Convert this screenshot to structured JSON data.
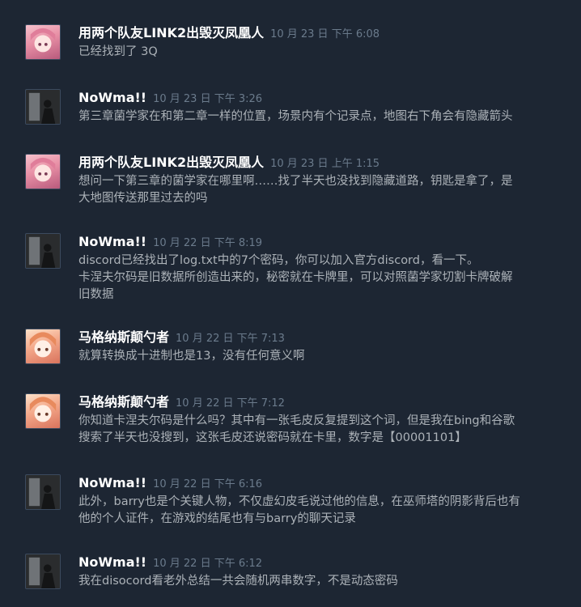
{
  "comments": [
    {
      "author": "用两个队友LINK2出毁灭凤凰人",
      "date": "10 月 23 日 下午 6:08",
      "avatar": "anime-girl-pink",
      "text": "已经找到了 3Q"
    },
    {
      "author": "NoWma!!",
      "date": "10 月 23 日 下午 3:26",
      "avatar": "dark-figure",
      "text": "第三章菌学家在和第二章一样的位置，场景内有个记录点，地图右下角会有隐藏箭头"
    },
    {
      "author": "用两个队友LINK2出毁灭凤凰人",
      "date": "10 月 23 日 上午 1:15",
      "avatar": "anime-girl-pink",
      "text": "想问一下第三章的菌学家在哪里啊……找了半天也没找到隐藏道路，钥匙是拿了，是\n大地图传送那里过去的吗"
    },
    {
      "author": "NoWma!!",
      "date": "10 月 22 日 下午 8:19",
      "avatar": "dark-figure",
      "text": "discord已经找出了log.txt中的7个密码，你可以加入官方discord，看一下。\n卡涅夫尔码是旧数据所创造出来的，秘密就在卡牌里，可以对照菌学家切割卡牌破解\n旧数据"
    },
    {
      "author": "马格纳斯颠勺者",
      "date": "10 月 22 日 下午 7:13",
      "avatar": "anime-girl-orange",
      "text": "就算转换成十进制也是13，没有任何意义啊"
    },
    {
      "author": "马格纳斯颠勺者",
      "date": "10 月 22 日 下午 7:12",
      "avatar": "anime-girl-orange",
      "text": "你知道卡涅夫尔码是什么吗？其中有一张毛皮反复提到这个词，但是我在bing和谷歌\n搜索了半天也没搜到，这张毛皮还说密码就在卡里，数字是【00001101】"
    },
    {
      "author": "NoWma!!",
      "date": "10 月 22 日 下午 6:16",
      "avatar": "dark-figure",
      "text": "此外，barry也是个关键人物，不仅虚幻皮毛说过他的信息，在巫师塔的阴影背后也有\n他的个人证件，在游戏的结尾也有与barry的聊天记录"
    },
    {
      "author": "NoWma!!",
      "date": "10 月 22 日 下午 6:12",
      "avatar": "dark-figure",
      "text": "我在disocord看老外总结一共会随机两串数字，不是动态密码"
    }
  ],
  "colors": {
    "background": "#1d2633",
    "author": "#ffffff",
    "date": "#6b7b8c",
    "text": "#acb2b8"
  }
}
